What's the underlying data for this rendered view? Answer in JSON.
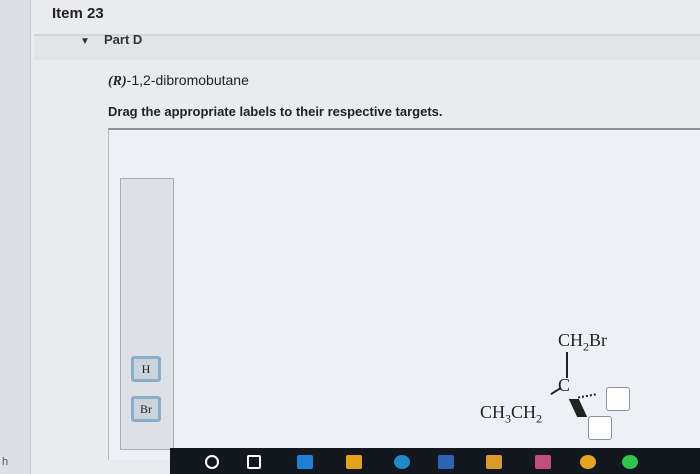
{
  "header": {
    "item_title": "Item 23",
    "part_label": "Part D",
    "left_fragment": "h"
  },
  "question": {
    "compound_prefix": "(R)",
    "compound_name": "-1,2-dibromobutane",
    "instruction": "Drag the appropriate labels to their respective targets."
  },
  "labels": [
    "H",
    "Br"
  ],
  "molecule": {
    "top_group": "CH₂Br",
    "center": "C",
    "left_group": "CH₃CH₂"
  },
  "taskbar": {
    "icons": [
      "search-icon",
      "task-view-icon",
      "app-icon-1",
      "app-icon-2",
      "app-icon-3",
      "app-icon-4",
      "app-icon-5",
      "app-icon-6",
      "app-icon-7",
      "app-icon-8"
    ],
    "colors": [
      "#1f7fd6",
      "#e5a31b",
      "#1e8ac8",
      "#2e63b8",
      "#d99a2b",
      "#c04f7f",
      "#e6a421",
      "#31c451"
    ]
  }
}
